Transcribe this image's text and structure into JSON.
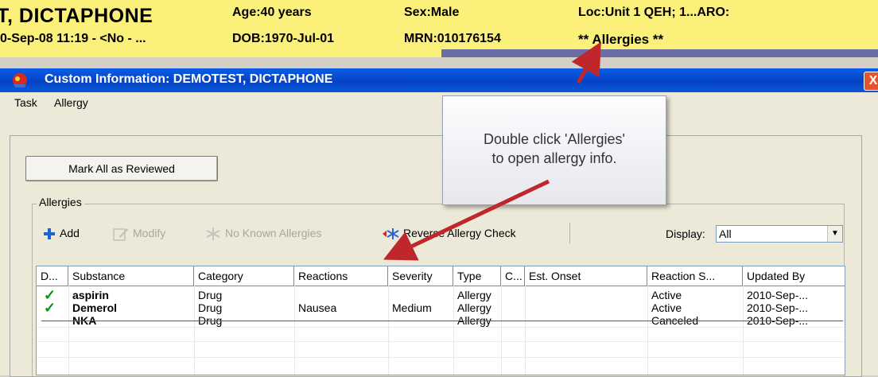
{
  "banner": {
    "name": "T, DICTAPHONE",
    "age": "Age:40 years",
    "sex": "Sex:Male",
    "loc": "Loc:Unit 1 QEH; 1...ARO:",
    "admit": "0-Sep-08 11:19 - <No - ...",
    "dob": "DOB:1970-Jul-01",
    "mrn": "MRN:010176154",
    "allergies": "** Allergies **"
  },
  "window": {
    "title": "Custom Information: DEMOTEST, DICTAPHONE",
    "close_glyph": "X"
  },
  "menu": [
    {
      "label": "Task"
    },
    {
      "label": "Allergy"
    }
  ],
  "mark_all_button": "Mark All as Reviewed",
  "group_label": "Allergies",
  "toolbar": {
    "add": "Add",
    "modify": "Modify",
    "no_known": "No Known Allergies",
    "reverse": "Reverse Allergy Check",
    "display_label": "Display:",
    "display_value": "All"
  },
  "table": {
    "columns": [
      "D...",
      "Substance",
      "Category",
      "Reactions",
      "Severity",
      "Type",
      "C...",
      "Est. Onset",
      "Reaction S...",
      "Updated By"
    ],
    "rows": [
      {
        "checked": true,
        "substance": "aspirin",
        "category": "Drug",
        "reactions": "",
        "severity": "",
        "type": "Allergy",
        "onset": "",
        "status": "Active",
        "updated": "2010-Sep-..."
      },
      {
        "checked": true,
        "substance": "Demerol",
        "category": "Drug",
        "reactions": "Nausea",
        "severity": "Medium",
        "type": "Allergy",
        "onset": "",
        "status": "Active",
        "updated": "2010-Sep-..."
      },
      {
        "checked": false,
        "substance": "NKA",
        "category": "Drug",
        "reactions": "",
        "severity": "",
        "type": "Allergy",
        "onset": "",
        "status": "Canceled",
        "updated": "2010-Sep-...",
        "struck": true
      }
    ]
  },
  "callout": {
    "line1": "Double click 'Allergies'",
    "line2": "to open allergy info."
  },
  "colors": {
    "banner_bg": "#fbf07a",
    "titlebar": "#0542c4",
    "arrow": "#c0272d",
    "check": "#0a8f16",
    "strike": "#e02020"
  }
}
